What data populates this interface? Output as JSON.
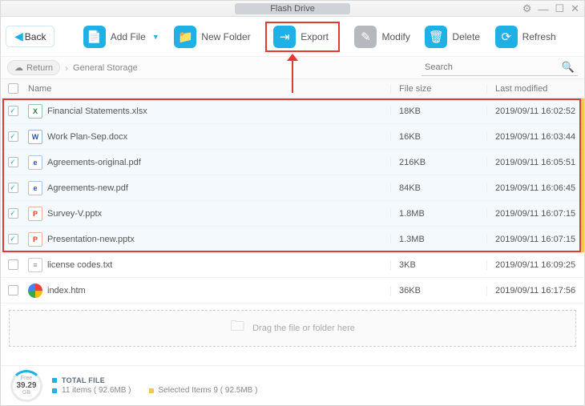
{
  "titlebar": {
    "title": "Flash Drive"
  },
  "toolbar": {
    "back": "Back",
    "add_file": "Add File",
    "new_folder": "New Folder",
    "export": "Export",
    "modify": "Modify",
    "delete": "Delete",
    "refresh": "Refresh"
  },
  "nav": {
    "return": "Return",
    "crumb": "General Storage",
    "search_placeholder": "Search"
  },
  "table": {
    "head": {
      "name": "Name",
      "size": "File size",
      "modified": "Last modified"
    },
    "rows": [
      {
        "selected": true,
        "icon": "xlsx",
        "name": "Financial Statements.xlsx",
        "size": "18KB",
        "modified": "2019/09/11 16:02:52"
      },
      {
        "selected": true,
        "icon": "docx",
        "name": "Work Plan-Sep.docx",
        "size": "16KB",
        "modified": "2019/09/11 16:03:44"
      },
      {
        "selected": true,
        "icon": "pdf",
        "name": "Agreements-original.pdf",
        "size": "216KB",
        "modified": "2019/09/11 16:05:51"
      },
      {
        "selected": true,
        "icon": "pdf",
        "name": "Agreements-new.pdf",
        "size": "84KB",
        "modified": "2019/09/11 16:06:45"
      },
      {
        "selected": true,
        "icon": "pptx",
        "name": "Survey-V.pptx",
        "size": "1.8MB",
        "modified": "2019/09/11 16:07:15"
      },
      {
        "selected": true,
        "icon": "pptx",
        "name": "Presentation-new.pptx",
        "size": "1.3MB",
        "modified": "2019/09/11 16:07:15"
      },
      {
        "selected": false,
        "icon": "txt",
        "name": "license codes.txt",
        "size": "3KB",
        "modified": "2019/09/11 16:09:25"
      },
      {
        "selected": false,
        "icon": "htm",
        "name": "index.htm",
        "size": "36KB",
        "modified": "2019/09/11 16:17:56"
      }
    ]
  },
  "dropzone": {
    "text": "Drag the file or folder here"
  },
  "footer": {
    "free_label": "Free",
    "free_value": "39.29",
    "free_unit": "GB",
    "total_label": "TOTAL FILE",
    "total_text": "11 items ( 92.6MB )",
    "selected_text": "Selected Items 9 ( 92.5MB )"
  },
  "icon_glyph": {
    "xlsx": "X",
    "docx": "W",
    "pdf": "e",
    "pptx": "P",
    "txt": "≡",
    "htm": ""
  }
}
